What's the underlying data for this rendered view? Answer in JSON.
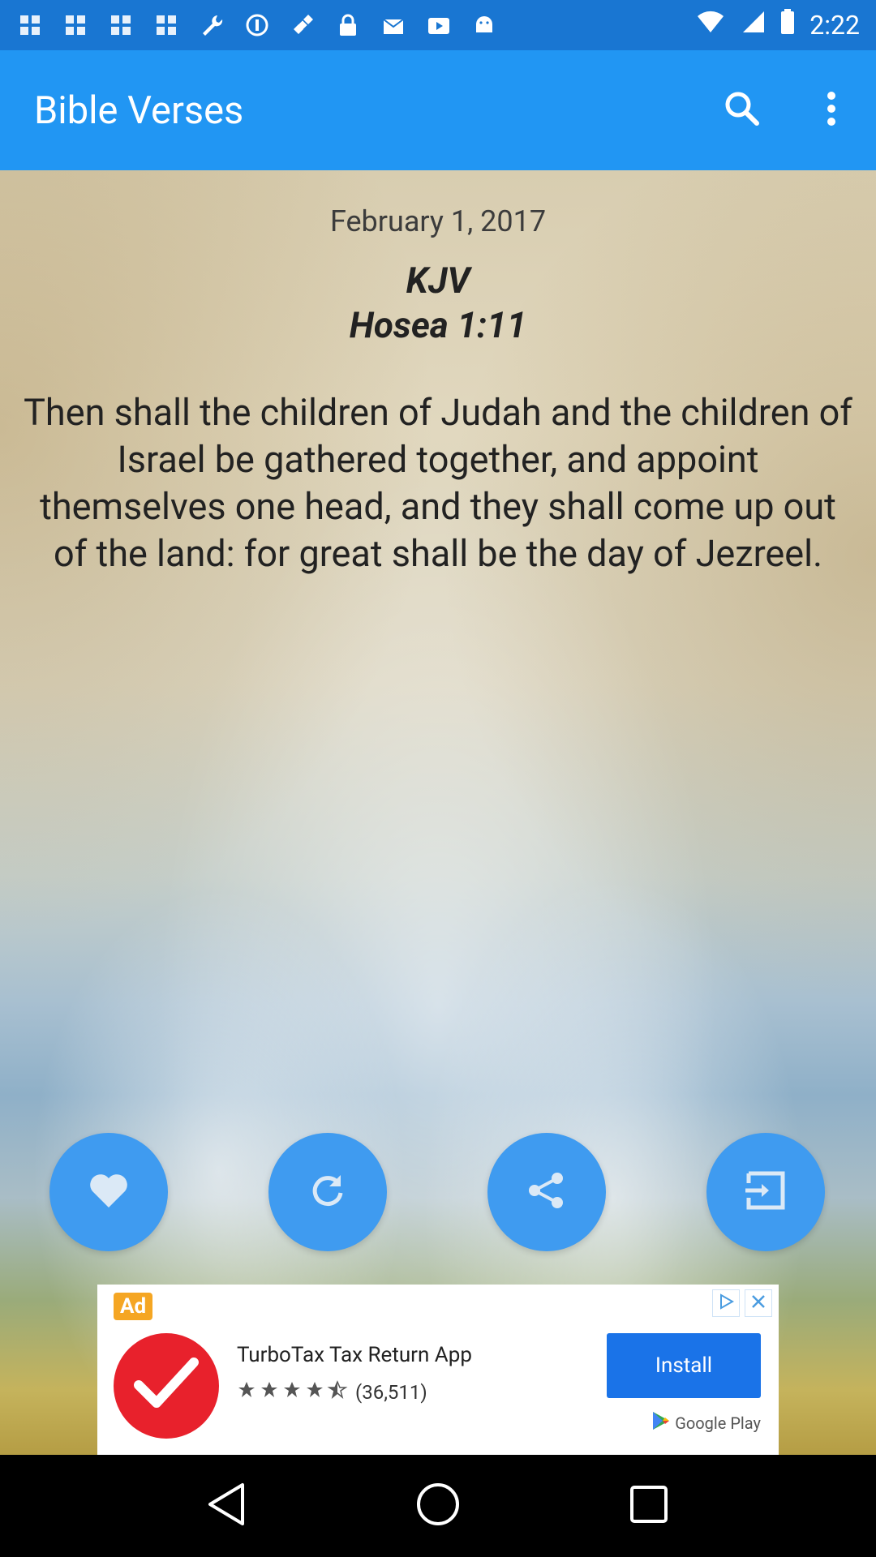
{
  "status_bar": {
    "time": "2:22",
    "notification_icons": [
      "fan-icon",
      "fan-icon",
      "fan-icon",
      "fan-icon",
      "wrench-icon",
      "info-icon",
      "satellite-icon",
      "lock-icon",
      "mail-icon",
      "youtube-icon",
      "android-icon"
    ],
    "icons": [
      "wifi-icon",
      "signal-icon",
      "battery-icon"
    ]
  },
  "app_bar": {
    "title": "Bible Verses",
    "actions": [
      "search-icon",
      "more-vert-icon"
    ],
    "color": "#2196f3"
  },
  "verse": {
    "date": "February 1, 2017",
    "version": "KJV",
    "reference": "Hosea 1:11",
    "text": "Then shall the children of Judah and the children of Israel be gathered together, and appoint themselves one head, and they shall come up out of the land: for great shall be the day of Jezreel."
  },
  "actions": [
    {
      "name": "favorite-button",
      "icon": "heart-icon"
    },
    {
      "name": "refresh-button",
      "icon": "refresh-icon"
    },
    {
      "name": "share-button",
      "icon": "share-icon"
    },
    {
      "name": "next-button",
      "icon": "exit-icon"
    }
  ],
  "ad": {
    "badge": "Ad",
    "title": "TurboTax Tax Return App",
    "rating_text": "(36,511)",
    "install_label": "Install",
    "store_label": "Google Play",
    "accent": "#e8212c"
  },
  "nav_bar": {
    "buttons": [
      "back-icon",
      "home-icon",
      "recents-icon"
    ]
  }
}
